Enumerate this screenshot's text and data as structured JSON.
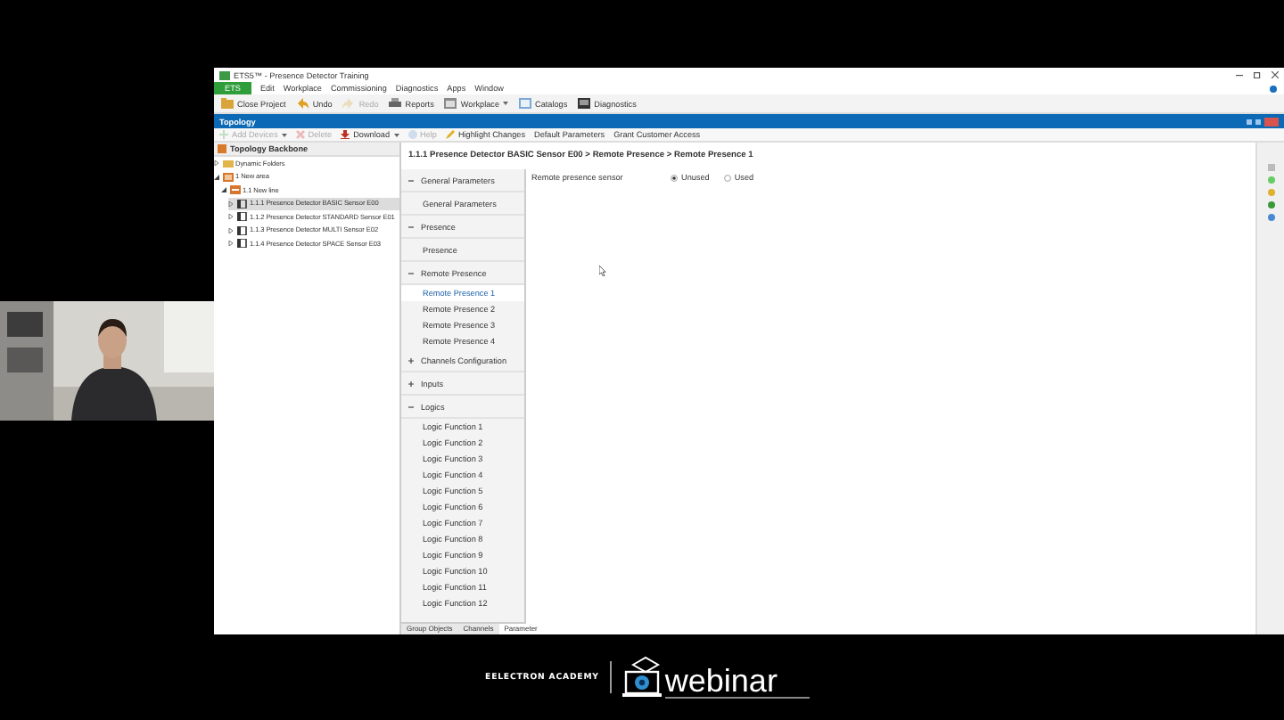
{
  "window": {
    "title": "ETS5™ - Presence Detector Training"
  },
  "menu": {
    "app_button": "ETS",
    "items": [
      "Edit",
      "Workplace",
      "Commissioning",
      "Diagnostics",
      "Apps",
      "Window"
    ]
  },
  "toolbar": [
    {
      "label": "Close Project",
      "kind": "close",
      "disabled": false,
      "dropdown": false
    },
    {
      "label": "Undo",
      "kind": "undo",
      "disabled": false,
      "dropdown": false
    },
    {
      "label": "Redo",
      "kind": "redo",
      "disabled": true,
      "dropdown": false
    },
    {
      "label": "Reports",
      "kind": "reports",
      "disabled": false,
      "dropdown": false
    },
    {
      "label": "Workplace",
      "kind": "workplace",
      "disabled": false,
      "dropdown": true
    },
    {
      "label": "Catalogs",
      "kind": "catalogs",
      "disabled": false,
      "dropdown": false
    },
    {
      "label": "Diagnostics",
      "kind": "diagnostics",
      "disabled": false,
      "dropdown": false
    }
  ],
  "panel": {
    "title": "Topology"
  },
  "panel_toolbar": [
    {
      "label": "Add Devices",
      "kind": "add",
      "disabled": true,
      "dropdown": true
    },
    {
      "label": "Delete",
      "kind": "delete",
      "disabled": true,
      "dropdown": false
    },
    {
      "label": "Download",
      "kind": "download",
      "disabled": false,
      "dropdown": true
    },
    {
      "label": "Help",
      "kind": "help",
      "disabled": true,
      "dropdown": false
    },
    {
      "label": "Highlight Changes",
      "kind": "highlight",
      "disabled": false,
      "dropdown": false
    },
    {
      "label": "Default Parameters",
      "kind": "text",
      "disabled": false,
      "dropdown": false
    },
    {
      "label": "Grant Customer Access",
      "kind": "text",
      "disabled": false,
      "dropdown": false
    }
  ],
  "tree": {
    "header": "Topology Backbone",
    "items": [
      {
        "label": "Dynamic Folders",
        "kind": "folder",
        "expanded": false,
        "selected": false
      },
      {
        "label": "1 New area",
        "kind": "area",
        "expanded": true,
        "selected": false,
        "children": [
          {
            "label": "1.1 New line",
            "kind": "line",
            "expanded": true,
            "selected": false,
            "children": [
              {
                "label": "1.1.1 Presence Detector BASIC Sensor E00",
                "kind": "device",
                "expanded": false,
                "selected": true
              },
              {
                "label": "1.1.2 Presence Detector STANDARD Sensor E01",
                "kind": "device",
                "expanded": false,
                "selected": false
              },
              {
                "label": "1.1.3 Presence Detector MULTI Sensor E02",
                "kind": "device",
                "expanded": false,
                "selected": false
              },
              {
                "label": "1.1.4 Presence Detector SPACE Sensor E03",
                "kind": "device",
                "expanded": false,
                "selected": false
              }
            ]
          }
        ]
      }
    ]
  },
  "parameters": {
    "breadcrumb": "1.1.1 Presence Detector BASIC Sensor E00 > Remote Presence > Remote Presence 1",
    "nav": [
      {
        "label": "General Parameters",
        "expanded": true,
        "children": [
          {
            "label": "General Parameters",
            "selected": false
          }
        ]
      },
      {
        "label": "Presence",
        "expanded": true,
        "children": [
          {
            "label": "Presence",
            "selected": false
          }
        ]
      },
      {
        "label": "Remote Presence",
        "expanded": true,
        "children": [
          {
            "label": "Remote Presence 1",
            "selected": true
          },
          {
            "label": "Remote Presence 2",
            "selected": false
          },
          {
            "label": "Remote Presence 3",
            "selected": false
          },
          {
            "label": "Remote Presence 4",
            "selected": false
          }
        ]
      },
      {
        "label": "Channels Configuration",
        "expanded": false
      },
      {
        "label": "Inputs",
        "expanded": false
      },
      {
        "label": "Logics",
        "expanded": true,
        "children": [
          {
            "label": "Logic Function 1",
            "selected": false
          },
          {
            "label": "Logic Function 2",
            "selected": false
          },
          {
            "label": "Logic Function 3",
            "selected": false
          },
          {
            "label": "Logic Function 4",
            "selected": false
          },
          {
            "label": "Logic Function 5",
            "selected": false
          },
          {
            "label": "Logic Function 6",
            "selected": false
          },
          {
            "label": "Logic Function 7",
            "selected": false
          },
          {
            "label": "Logic Function 8",
            "selected": false
          },
          {
            "label": "Logic Function 9",
            "selected": false
          },
          {
            "label": "Logic Function 10",
            "selected": false
          },
          {
            "label": "Logic Function 11",
            "selected": false
          },
          {
            "label": "Logic Function 12",
            "selected": false
          }
        ]
      }
    ],
    "rows": [
      {
        "label": "Remote presence sensor",
        "options": [
          {
            "label": "Unused",
            "selected": true
          },
          {
            "label": "Used",
            "selected": false
          }
        ]
      }
    ],
    "tabs": [
      {
        "label": "Group Objects",
        "selected": false
      },
      {
        "label": "Channels",
        "selected": false
      },
      {
        "label": "Parameter",
        "selected": true
      }
    ]
  },
  "brand": {
    "name": "EELECTRON ACADEMY",
    "product": "webinar"
  }
}
